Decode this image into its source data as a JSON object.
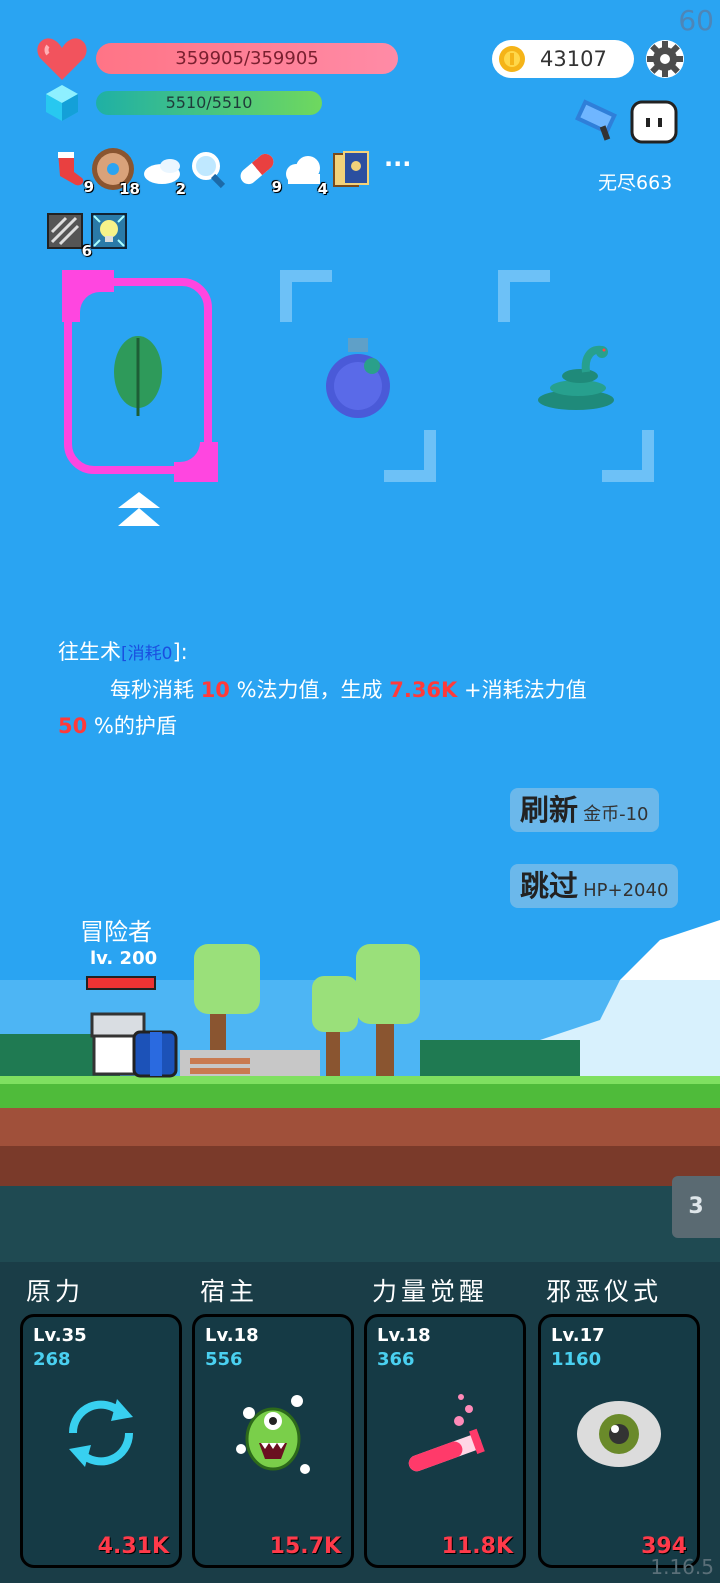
{
  "fps": "60",
  "hp": {
    "text": "359905/359905"
  },
  "mp": {
    "text": "5510/5510"
  },
  "gold": {
    "value": "43107"
  },
  "mode": {
    "label": "无尽663"
  },
  "inventory": {
    "items": [
      {
        "icon": "sock-icon",
        "count": "9"
      },
      {
        "icon": "donut-icon",
        "count": "18"
      },
      {
        "icon": "wing-icon",
        "count": "2"
      },
      {
        "icon": "magnifier-icon",
        "count": ""
      },
      {
        "icon": "pill-icon",
        "count": "9"
      },
      {
        "icon": "cloud-icon",
        "count": "4"
      },
      {
        "icon": "card-icon",
        "count": ""
      }
    ],
    "more": "···",
    "row2": [
      {
        "icon": "book-icon",
        "count": "6"
      },
      {
        "icon": "lightbulb-icon",
        "count": ""
      }
    ]
  },
  "choices": [
    {
      "icon": "leaf-icon",
      "selected": true
    },
    {
      "icon": "potion-icon",
      "selected": false
    },
    {
      "icon": "snake-icon",
      "selected": false
    }
  ],
  "skill": {
    "name": "往生术",
    "cost_label": "[",
    "cost_text": "消耗0",
    "cost_end": "]:",
    "line1_a": "每秒消耗 ",
    "line1_b": "10",
    "line1_c": " %法力值，生成 ",
    "line1_d": "7.36K",
    "line1_e": " +消耗法力值",
    "line2_a": "50",
    "line2_b": " %的护盾"
  },
  "buttons": {
    "refresh": {
      "label": "刷新",
      "sub": "金币-10"
    },
    "skip": {
      "label": "跳过",
      "sub": "HP+2040"
    }
  },
  "hero": {
    "name": "冒险者",
    "level": "lv. 200"
  },
  "stage_badge": "3",
  "skills": [
    {
      "name": "原力",
      "lv": "Lv.35",
      "cost": "268",
      "value": "4.31K",
      "icon": "cycle-icon"
    },
    {
      "name": "宿主",
      "lv": "Lv.18",
      "cost": "556",
      "value": "15.7K",
      "icon": "germ-icon"
    },
    {
      "name": "力量觉醒",
      "lv": "Lv.18",
      "cost": "366",
      "value": "11.8K",
      "icon": "test-tube-icon"
    },
    {
      "name": "邪恶仪式",
      "lv": "Lv.17",
      "cost": "1160",
      "value": "394",
      "icon": "eye-icon"
    }
  ],
  "version": "1.16.5"
}
